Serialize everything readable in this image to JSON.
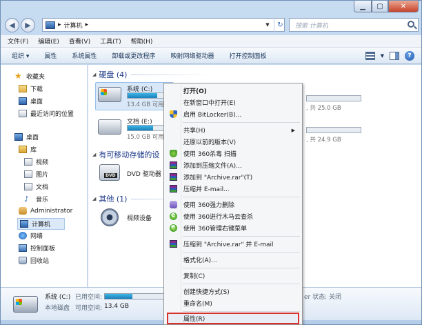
{
  "address": {
    "path": "计算机",
    "search_placeholder": "搜索 计算机"
  },
  "menubar": [
    "文件(F)",
    "编辑(E)",
    "查看(V)",
    "工具(T)",
    "帮助(H)"
  ],
  "commandbar": [
    "组织 ▾",
    "属性",
    "系统属性",
    "卸载或更改程序",
    "映射网络驱动器",
    "打开控制面板"
  ],
  "nav": {
    "favorites": "收藏夹",
    "downloads": "下载",
    "desktop_fav": "桌面",
    "recent": "最近访问的位置",
    "desktop": "桌面",
    "libraries": "库",
    "videos": "视频",
    "pictures": "图片",
    "documents": "文档",
    "music": "音乐",
    "admin": "Administrator",
    "computer": "计算机",
    "network": "网络",
    "control_panel": "控制面板",
    "recycle": "回收站"
  },
  "groups": {
    "hdd": "硬盘 (4)",
    "removable": "有可移动存储的设",
    "other": "其他 (1)"
  },
  "drives": {
    "c": {
      "name": "系统 (C:)",
      "free": "13.4 GB 可用",
      "fill": 0.46
    },
    "e": {
      "name": "文档 (E:)",
      "free": "15.0 GB 可用",
      "fill": 0.4
    },
    "d_total": ", 共 25.0 GB",
    "f_total": ", 共 24.9 GB",
    "dvd": "DVD 驱动器 (",
    "video_device": "视频设备"
  },
  "details": {
    "name": "系统 (C:)",
    "used_label": "已用空间:",
    "type": "本地磁盘",
    "free_label": "可用空间:",
    "free_value": "13.4 GB",
    "status": "er 状态: 关闭",
    "fill": 0.46
  },
  "context_menu": {
    "open": "打开(O)",
    "open_new": "在新窗口中打开(E)",
    "bitlocker": "启用 BitLocker(B)...",
    "share": "共享(H)",
    "restore": "还原以前的版本(V)",
    "scan360": "使用 360杀毒 扫描",
    "add_archive": "添加到压缩文件(A)...",
    "add_rar": "添加到 \"Archive.rar\"(T)",
    "compress_email": "压缩并 E-mail...",
    "force_delete": "使用 360强力删除",
    "trojan": "使用 360进行木马云查杀",
    "menu_mgr": "使用 360管理右键菜单",
    "compress_rar_email": "压缩到 \"Archive.rar\" 并 E-mail",
    "format": "格式化(A)...",
    "copy": "复制(C)",
    "shortcut": "创建快捷方式(S)",
    "rename": "重命名(M)",
    "properties": "属性(R)"
  }
}
